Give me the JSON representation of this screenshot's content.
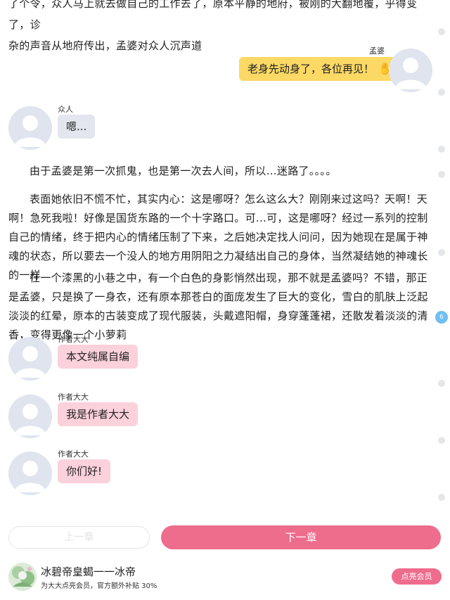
{
  "story": {
    "top_lines": [
      "了个令，众人马上就去做自己的工作去了，原本平静的地府，被刚的大翻地覆，乎得变了，诊",
      "杂的声音从地府传出，孟婆对众人沉声道"
    ],
    "para1": "由于孟婆是第一次抓鬼，也是第一次去人间，所以…迷路了。。。。",
    "para2": "表面她依旧不慌不忙，其实内心：这是哪呀？怎么这么大？刚刚来过这吗？天啊！天啊！急死我啦！好像是国货东路的一个十字路口。可...可，这是哪呀？经过一系列的控制自己的情绪，终于把内心的情绪压制了下来，之后她决定找人问问，因为她现在是属于神魂的状态，所以要去一个没人的地方用阴阳之力凝结出自己的身体，当然凝结她的神魂长的一样",
    "para3": "在一个漆黑的小巷之中，有一个白色的身影悄然出现，那不就是孟婆吗？不错，那正是孟婆，只是换了一身衣，还有原本那苍白的面庞发生了巨大的变化，雪白的肌肤上泛起淡淡的红晕，原本的古装变成了现代服装，头戴遮阳帽，身穿蓬蓬裙，还散发着淡淡的清香，变得更像一个小萝莉"
  },
  "chat": {
    "mengpo": {
      "speaker": "孟婆",
      "text": "老身先动身了，各位再见！",
      "emoji": "✋"
    },
    "crowd": {
      "speaker": "众人",
      "text": "嗯..."
    },
    "author1": {
      "speaker": "作者大大",
      "text": "本文纯属自编"
    },
    "author2": {
      "speaker": "作者大大",
      "text": "我是作者大大"
    },
    "author3": {
      "speaker": "作者大大",
      "text": "你们好!"
    }
  },
  "page_badge": "6",
  "nav": {
    "prev_label": "上一章",
    "next_label": "下一章"
  },
  "footer": {
    "title": "冰碧帝皇蝎一一冰帝",
    "subtitle": "为大大点亮会员，官方额外补贴 30%",
    "member_button": "点亮会员"
  },
  "colors": {
    "accent_pink": "#ee6c8c",
    "bubble_yellow": "#fcd964",
    "bubble_pink": "#fbd1dc",
    "bubble_grey": "#e3e6ee",
    "badge_blue": "#6fbff3"
  }
}
